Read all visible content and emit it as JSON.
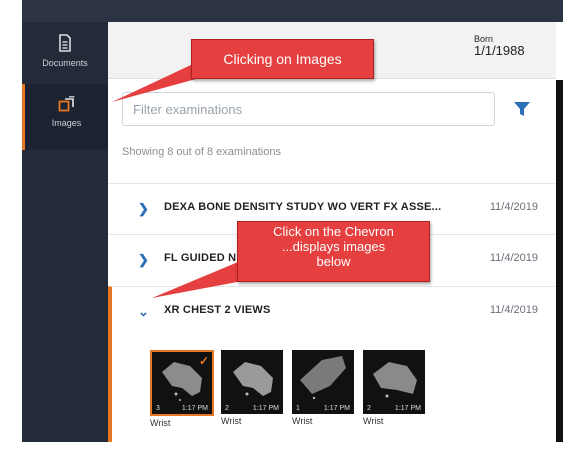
{
  "sidebar": {
    "items": [
      {
        "label": "Documents",
        "icon": "document-icon"
      },
      {
        "label": "Images",
        "icon": "images-icon",
        "active": true
      }
    ]
  },
  "header": {
    "born_label": "Born",
    "born_value": "1/1/1988"
  },
  "search": {
    "placeholder": "Filter examinations"
  },
  "showing_text": "Showing 8 out of 8 examinations",
  "exams": [
    {
      "title": "DEXA BONE DENSITY STUDY WO VERT FX ASSE...",
      "date": "11/4/2019",
      "expanded": false
    },
    {
      "title": "FL GUIDED N",
      "date": "11/4/2019",
      "expanded": false
    },
    {
      "title": "XR CHEST 2 VIEWS",
      "date": "11/4/2019",
      "expanded": true
    }
  ],
  "thumbnails": [
    {
      "count": "3",
      "time": "1:17 PM",
      "label": "Wrist",
      "selected": true
    },
    {
      "count": "2",
      "time": "1:17 PM",
      "label": "Wrist",
      "selected": false
    },
    {
      "count": "1",
      "time": "1:17 PM",
      "label": "Wrist",
      "selected": false
    },
    {
      "count": "2",
      "time": "1:17 PM",
      "label": "Wrist",
      "selected": false
    }
  ],
  "callouts": {
    "one": "Clicking on Images",
    "two_line1": "Click on the Chevron",
    "two_line2": "...displays images",
    "two_line3": "below"
  },
  "colors": {
    "accent": "#e87722",
    "link_blue": "#2c6fb7",
    "callout_red": "#e53f3f",
    "sidebar_bg": "#232a38"
  }
}
